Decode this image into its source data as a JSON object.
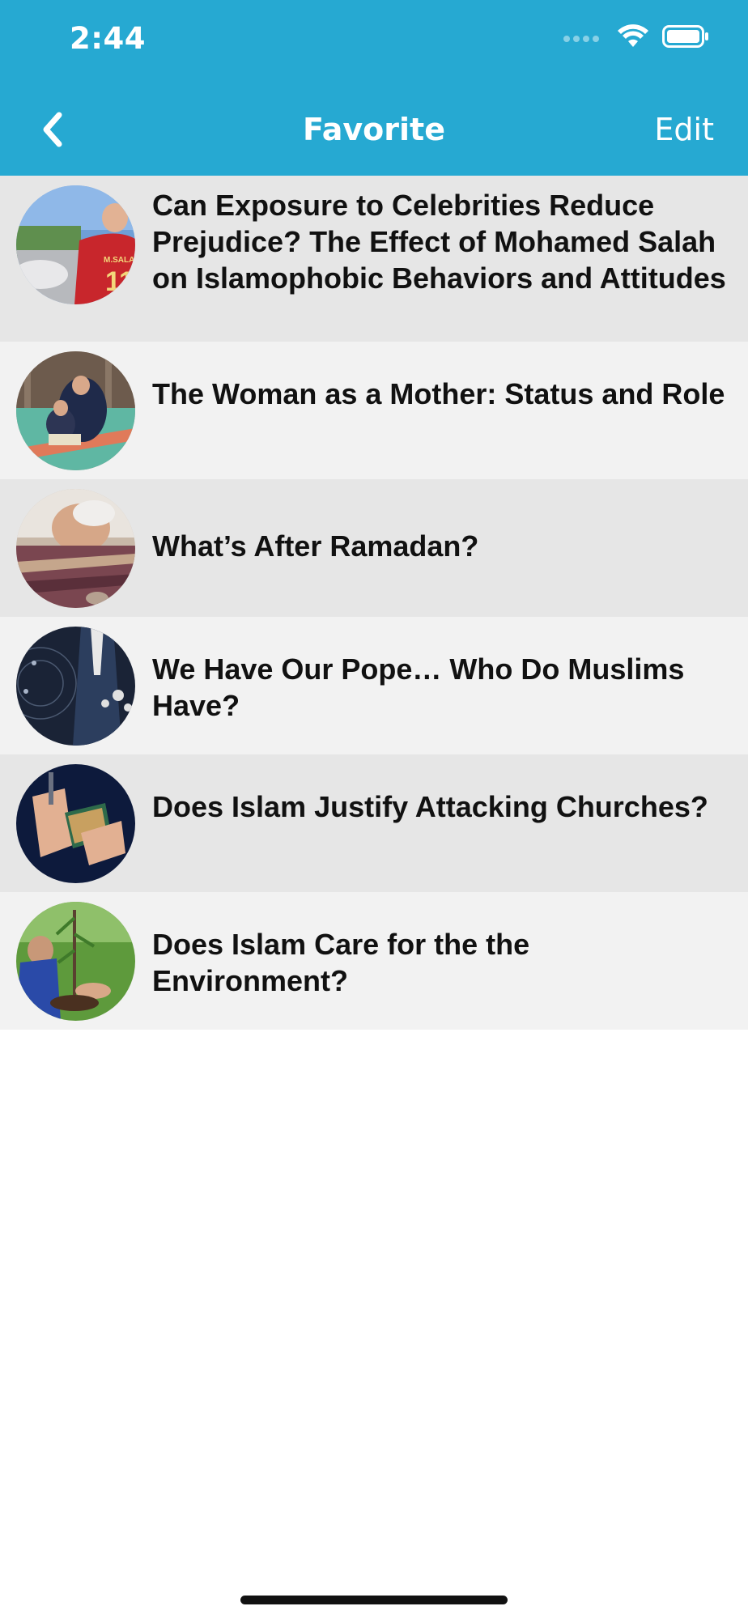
{
  "status_bar": {
    "time": "2:44"
  },
  "nav": {
    "title": "Favorite",
    "edit_label": "Edit",
    "back_icon": "chevron-left-icon"
  },
  "colors": {
    "header": "#26a9d2",
    "row_dark": "#e6e6e6",
    "row_light": "#f2f2f2"
  },
  "favorites": [
    {
      "title": "Can Exposure to Celebrities Reduce Prejudice? The Effect of Mohamed Salah on Islamophobic Behaviors and Attitudes",
      "thumbnail": "football-player-photo"
    },
    {
      "title": "The Woman as a Mother: Status and Role",
      "thumbnail": "mother-and-child-reading-photo"
    },
    {
      "title": "What’s After Ramadan?",
      "thumbnail": "prostrating-man-photo"
    },
    {
      "title": "We Have Our Pope… Who Do Muslims Have?",
      "thumbnail": "businessman-network-photo"
    },
    {
      "title": "Does Islam Justify Attacking Churches?",
      "thumbnail": "hands-with-book-photo"
    },
    {
      "title": "Does Islam Care for the the Environment?",
      "thumbnail": "child-planting-tree-photo"
    }
  ]
}
